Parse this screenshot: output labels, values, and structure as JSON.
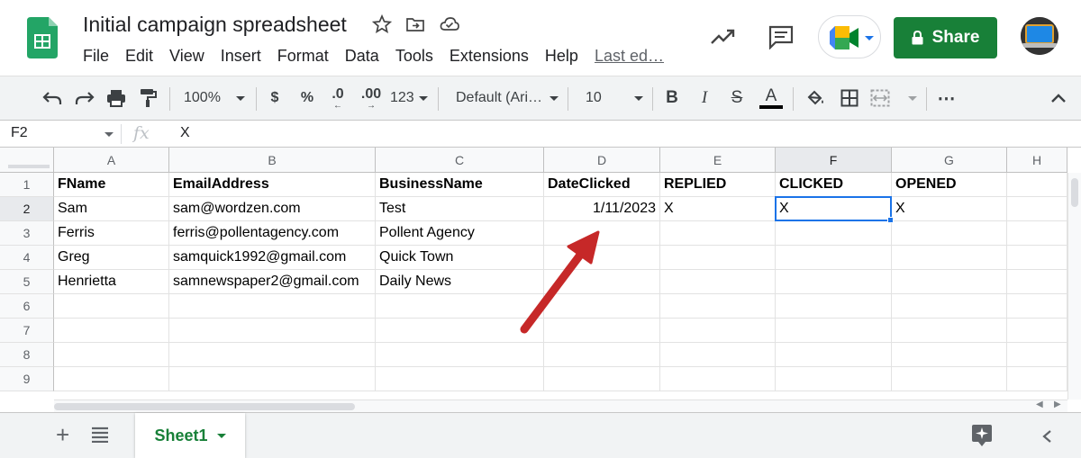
{
  "doc": {
    "title": "Initial campaign spreadsheet",
    "menu": [
      "File",
      "Edit",
      "View",
      "Insert",
      "Format",
      "Data",
      "Tools",
      "Extensions",
      "Help"
    ],
    "last_edit": "Last ed…",
    "share_label": "Share"
  },
  "toolbar": {
    "zoom": "100%",
    "currency": "$",
    "percent": "%",
    "decrease_decimals": ".0",
    "increase_decimals": ".00",
    "more_formats": "123",
    "font": "Default (Ari…",
    "font_size": "10",
    "bold": "B",
    "italic": "I",
    "strikethrough": "S",
    "text_color": "A"
  },
  "formula_bar": {
    "cell_ref": "F2",
    "fx": "fx",
    "value": "X"
  },
  "grid": {
    "columns": [
      "A",
      "B",
      "C",
      "D",
      "E",
      "F",
      "G",
      "H"
    ],
    "rows": [
      "1",
      "2",
      "3",
      "4",
      "5",
      "6",
      "7",
      "8",
      "9"
    ],
    "cells": [
      [
        "FName",
        "EmailAddress",
        "BusinessName",
        "DateClicked",
        "REPLIED",
        "CLICKED",
        "OPENED",
        ""
      ],
      [
        "Sam",
        "sam@wordzen.com",
        "Test",
        "1/11/2023",
        "X",
        "X",
        "X",
        ""
      ],
      [
        "Ferris",
        "ferris@pollentagency.com",
        "Pollent Agency",
        "",
        "",
        "",
        "",
        ""
      ],
      [
        "Greg",
        "samquick1992@gmail.com",
        "Quick Town",
        "",
        "",
        "",
        "",
        ""
      ],
      [
        "Henrietta",
        "samnewspaper2@gmail.com",
        "Daily News",
        "",
        "",
        "",
        "",
        ""
      ],
      [
        "",
        "",
        "",
        "",
        "",
        "",
        "",
        ""
      ],
      [
        "",
        "",
        "",
        "",
        "",
        "",
        "",
        ""
      ],
      [
        "",
        "",
        "",
        "",
        "",
        "",
        "",
        ""
      ],
      [
        "",
        "",
        "",
        "",
        "",
        "",
        "",
        ""
      ]
    ],
    "selected_column": "F",
    "selected_row": "2"
  },
  "sheets": {
    "active": "Sheet1"
  },
  "colors": {
    "share_green": "#188038",
    "selection_blue": "#1a73e8",
    "annotation_arrow": "#c62828"
  }
}
